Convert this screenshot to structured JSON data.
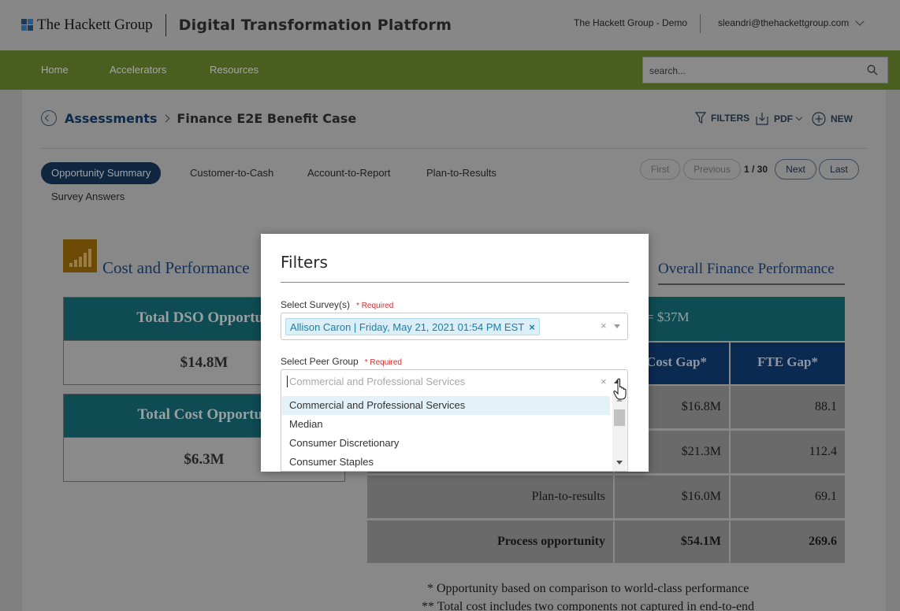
{
  "header": {
    "brand": "The Hackett Group",
    "app_title": "Digital Transformation Platform",
    "tenant": "The Hackett Group - Demo",
    "user_email": "sleandri@thehackettgroup.com"
  },
  "nav": {
    "items": [
      "Home",
      "Accelerators",
      "Resources"
    ],
    "search_placeholder": "search..."
  },
  "breadcrumb": {
    "parent": "Assessments",
    "current": "Finance E2E Benefit Case"
  },
  "actions": {
    "filters": "FILTERS",
    "pdf": "PDF",
    "new": "NEW"
  },
  "tabs": {
    "active": "Opportunity Summary",
    "items": [
      "Customer-to-Cash",
      "Account-to-Report",
      "Plan-to-Results",
      "Survey Answers"
    ]
  },
  "pager": {
    "first": "First",
    "previous": "Previous",
    "count": "1 / 30",
    "next": "Next",
    "last": "Last"
  },
  "report": {
    "title_left": "Cost and Performance",
    "title_right": "Overall Finance Performance",
    "kpis": [
      {
        "label": "Total DSO Opportun",
        "value": "$14.8M"
      },
      {
        "label": "Total Cost Opportun",
        "value": "$6.3M"
      }
    ],
    "banner": "= $37M",
    "headers": [
      "Cost Gap*",
      "FTE Gap*"
    ],
    "rows": [
      {
        "label": "",
        "cost": "$16.8M",
        "fte": "88.1"
      },
      {
        "label": "",
        "cost": "$21.3M",
        "fte": "112.4"
      },
      {
        "label": "Plan-to-results",
        "cost": "$16.0M",
        "fte": "69.1"
      },
      {
        "label": "Process opportunity",
        "cost": "$54.1M",
        "fte": "269.6"
      }
    ],
    "footnote1": "* Opportunity based on comparison to world-class performance",
    "footnote2": "** Total cost includes two components not captured in end-to-end"
  },
  "modal": {
    "title": "Filters",
    "survey_label": "Select Survey(s)",
    "required": "* Required",
    "survey_tag": "Allison Caron | Friday, May 21, 2021 01:54 PM EST",
    "tag_remove": "×",
    "clear": "×",
    "peer_label": "Select Peer Group",
    "peer_placeholder": "Commercial and Professional Services",
    "options": [
      "Commercial and Professional Services",
      "Median",
      "Consumer Discretionary",
      "Consumer Staples"
    ]
  }
}
